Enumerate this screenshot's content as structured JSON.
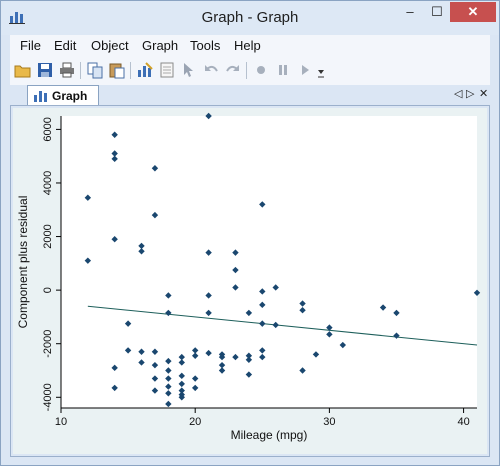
{
  "window": {
    "title": "Graph - Graph",
    "minimize": "–",
    "maximize": "☐",
    "close": "✕"
  },
  "menu": [
    "File",
    "Edit",
    "Object",
    "Graph",
    "Tools",
    "Help"
  ],
  "toolbar_icons": [
    "open-icon",
    "save-icon",
    "print-icon",
    "copy-icon",
    "paste-icon",
    "graph-editor-icon",
    "data-editor-icon",
    "pointer-icon",
    "undo-icon",
    "redo-icon",
    "record-icon",
    "pause-icon",
    "play-icon",
    "dropdown-icon"
  ],
  "tab": {
    "label": "Graph",
    "prev": "◁",
    "next": "▷",
    "close": "✕"
  },
  "colors": {
    "marker": "#1a476f",
    "line": "#1c5e5a",
    "plot_bg": "#ffffff",
    "graph_bg": "#eaf2f3",
    "close_btn": "#c7504f"
  },
  "chart_data": {
    "type": "scatter",
    "title": "",
    "xlabel": "Mileage (mpg)",
    "ylabel": "Component plus residual",
    "xlim": [
      10,
      41
    ],
    "ylim": [
      -4400,
      6500
    ],
    "xticks": [
      10,
      20,
      30,
      40
    ],
    "yticks": [
      -4000,
      -2000,
      0,
      2000,
      4000,
      6000
    ],
    "grid": false,
    "points": [
      [
        12,
        3450
      ],
      [
        12,
        1100
      ],
      [
        14,
        5800
      ],
      [
        14,
        5100
      ],
      [
        14,
        4900
      ],
      [
        14,
        1900
      ],
      [
        14,
        -2900
      ],
      [
        14,
        -3650
      ],
      [
        15,
        -1250
      ],
      [
        15,
        -2250
      ],
      [
        16,
        1650
      ],
      [
        16,
        1450
      ],
      [
        16,
        -2300
      ],
      [
        16,
        -2700
      ],
      [
        17,
        4550
      ],
      [
        17,
        2800
      ],
      [
        17,
        -2300
      ],
      [
        17,
        -2800
      ],
      [
        17,
        -3300
      ],
      [
        17,
        -3750
      ],
      [
        18,
        -200
      ],
      [
        18,
        -850
      ],
      [
        18,
        -2650
      ],
      [
        18,
        -3000
      ],
      [
        18,
        -3300
      ],
      [
        18,
        -3600
      ],
      [
        18,
        -3850
      ],
      [
        18,
        -4250
      ],
      [
        19,
        -2500
      ],
      [
        19,
        -2700
      ],
      [
        19,
        -3200
      ],
      [
        19,
        -3500
      ],
      [
        19,
        -3750
      ],
      [
        19,
        -3900
      ],
      [
        19,
        -4000
      ],
      [
        20,
        -2250
      ],
      [
        20,
        -2450
      ],
      [
        20,
        -3300
      ],
      [
        20,
        -3650
      ],
      [
        21,
        6500
      ],
      [
        21,
        1400
      ],
      [
        21,
        -200
      ],
      [
        21,
        -850
      ],
      [
        21,
        -2350
      ],
      [
        22,
        -2400
      ],
      [
        22,
        -2500
      ],
      [
        22,
        -2800
      ],
      [
        22,
        -3000
      ],
      [
        23,
        1400
      ],
      [
        23,
        750
      ],
      [
        23,
        100
      ],
      [
        23,
        -2500
      ],
      [
        24,
        -850
      ],
      [
        24,
        -2450
      ],
      [
        24,
        -2600
      ],
      [
        24,
        -3150
      ],
      [
        25,
        3200
      ],
      [
        25,
        -50
      ],
      [
        25,
        -550
      ],
      [
        25,
        -1250
      ],
      [
        25,
        -2250
      ],
      [
        25,
        -2500
      ],
      [
        26,
        100
      ],
      [
        26,
        -1300
      ],
      [
        28,
        -500
      ],
      [
        28,
        -750
      ],
      [
        28,
        -3000
      ],
      [
        29,
        -2400
      ],
      [
        30,
        -1400
      ],
      [
        30,
        -1650
      ],
      [
        31,
        -2050
      ],
      [
        34,
        -650
      ],
      [
        35,
        -850
      ],
      [
        35,
        -1700
      ],
      [
        41,
        -100
      ]
    ],
    "fit_line": [
      [
        12,
        -600
      ],
      [
        41,
        -2050
      ]
    ]
  }
}
